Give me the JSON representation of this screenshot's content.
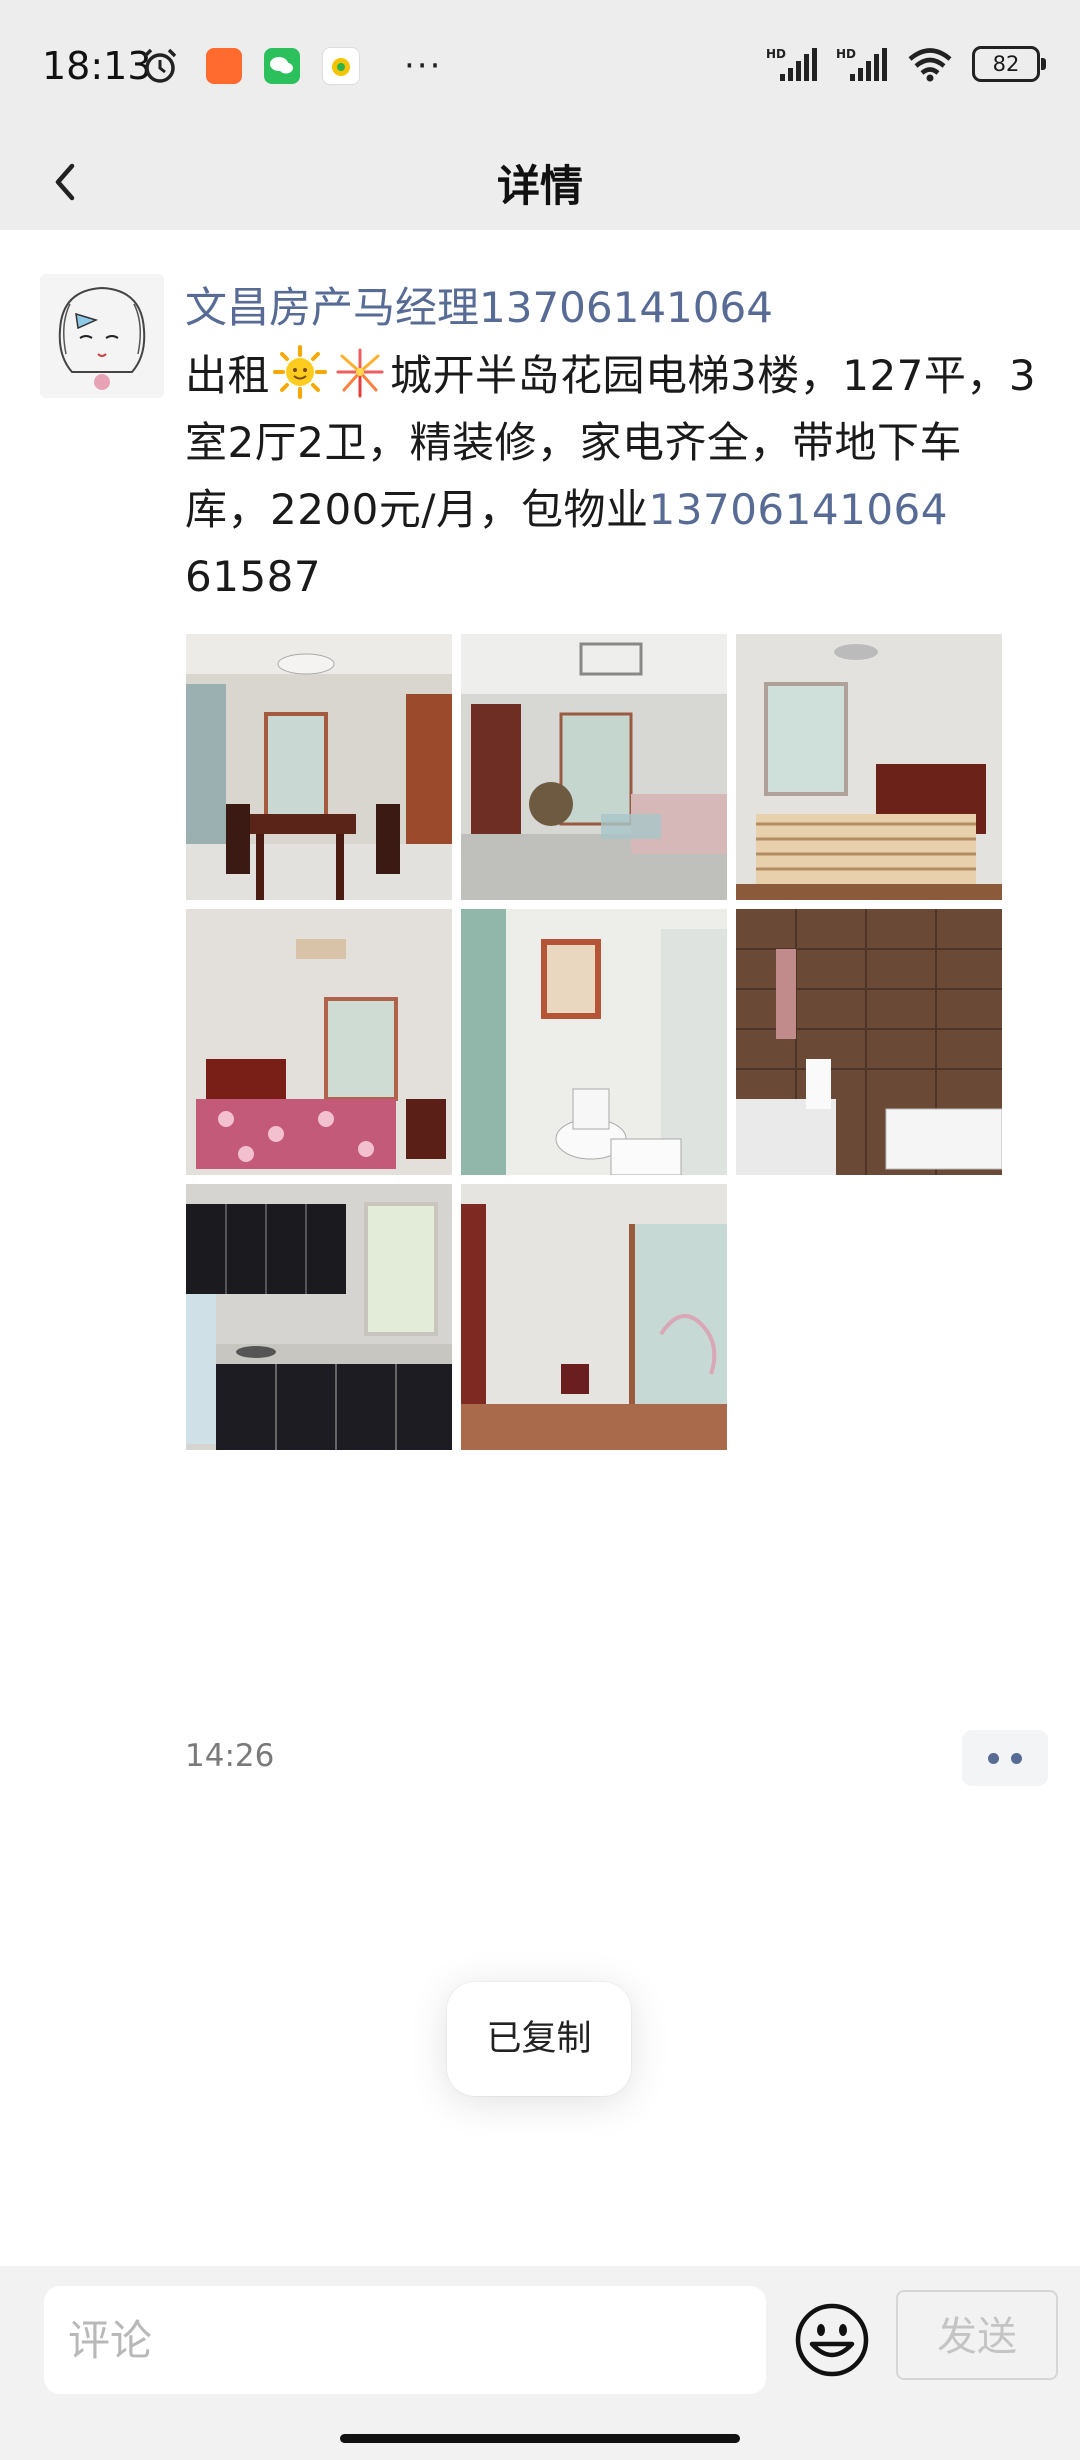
{
  "status_bar": {
    "time": "18:13",
    "more": "···",
    "battery": "82",
    "icons": [
      "alarm-icon",
      "taobao-app-icon",
      "wechat-app-icon",
      "music-app-icon",
      "hd-signal-icon",
      "hd-signal-icon",
      "wifi-icon",
      "battery-icon"
    ]
  },
  "nav": {
    "title": "详情",
    "back_icon": "chevron-left-icon"
  },
  "post": {
    "author": "文昌房产马经理13706141064",
    "content_1": "出租",
    "content_2": "城开半岛花园电梯3楼，127平，3室2厅2卫，精装修，家电齐全，带地下车库，2200元/月，包物业",
    "content_phone": "13706141064",
    "content_3": "61587",
    "emojis": [
      "sun-emoji",
      "fireworks-emoji"
    ],
    "photos": [
      "dining-room",
      "living-room",
      "bedroom-bedframe",
      "bedroom-bed",
      "bathroom-toilet",
      "bathroom-tub",
      "kitchen",
      "empty-room"
    ],
    "time": "14:26"
  },
  "toast": {
    "text": "已复制"
  },
  "comment": {
    "placeholder": "评论",
    "send_label": "发送"
  },
  "colors": {
    "link": "#576b95",
    "nav_bg": "#ededed",
    "bar_bg": "#f2f2f2"
  }
}
